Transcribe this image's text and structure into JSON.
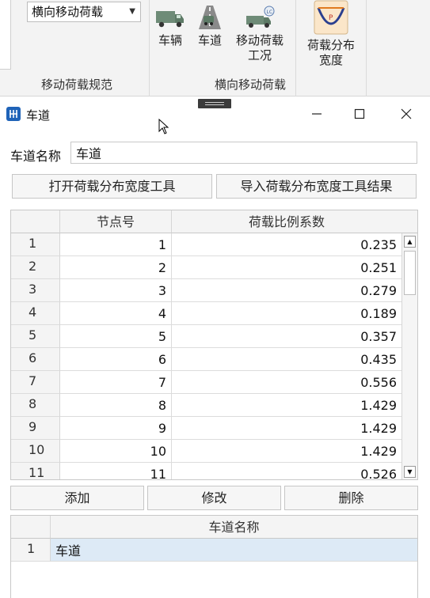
{
  "ribbon": {
    "combo_value": "横向移动荷载",
    "group1_label": "移动荷载规范",
    "group2_label": "横向移动荷载",
    "buttons": {
      "vehicle": "车辆",
      "lane": "车道",
      "moving_load_line1": "移动荷载",
      "moving_load_line2": "工况",
      "load_dist_line1": "荷载分布",
      "load_dist_line2": "宽度"
    }
  },
  "window": {
    "title": "车道",
    "icons": [
      "app-icon",
      "minimize-icon",
      "maximize-icon",
      "close-icon"
    ]
  },
  "form": {
    "lane_name_label": "车道名称",
    "lane_name_value": "车道",
    "open_tool_button": "打开荷载分布宽度工具",
    "import_result_button": "导入荷载分布宽度工具结果"
  },
  "table": {
    "columns": [
      "节点号",
      "荷载比例系数"
    ],
    "rows": [
      {
        "n": "1",
        "node": "1",
        "coef": "0.235"
      },
      {
        "n": "2",
        "node": "2",
        "coef": "0.251"
      },
      {
        "n": "3",
        "node": "3",
        "coef": "0.279"
      },
      {
        "n": "4",
        "node": "4",
        "coef": "0.189"
      },
      {
        "n": "5",
        "node": "5",
        "coef": "0.357"
      },
      {
        "n": "6",
        "node": "6",
        "coef": "0.435"
      },
      {
        "n": "7",
        "node": "7",
        "coef": "0.556"
      },
      {
        "n": "8",
        "node": "8",
        "coef": "1.429"
      },
      {
        "n": "9",
        "node": "9",
        "coef": "1.429"
      },
      {
        "n": "10",
        "node": "10",
        "coef": "1.429"
      },
      {
        "n": "11",
        "node": "11",
        "coef": "0.526"
      }
    ]
  },
  "actions": {
    "add": "添加",
    "modify": "修改",
    "delete": "删除"
  },
  "lane_list": {
    "column": "车道名称",
    "rows": [
      {
        "n": "1",
        "name": "车道"
      }
    ]
  },
  "colors": {
    "selected_row": "#ddeaf6",
    "app_icon": "#1f63b8",
    "accent_orange": "#e07a1f"
  }
}
